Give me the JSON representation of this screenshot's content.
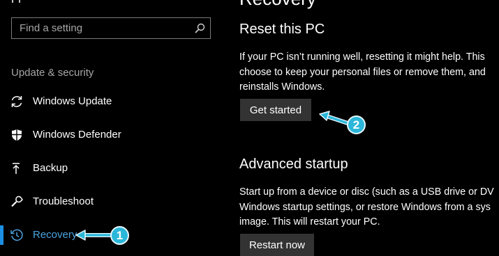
{
  "sidebar": {
    "search": {
      "placeholder": "Find a setting",
      "value": ""
    },
    "section_label": "Update & security",
    "items": [
      {
        "label": "Windows Update",
        "icon": "sync-icon",
        "selected": false
      },
      {
        "label": "Windows Defender",
        "icon": "shield-icon",
        "selected": false
      },
      {
        "label": "Backup",
        "icon": "backup-arrow-icon",
        "selected": false
      },
      {
        "label": "Troubleshoot",
        "icon": "wrench-icon",
        "selected": false
      },
      {
        "label": "Recovery",
        "icon": "history-icon",
        "selected": true
      }
    ]
  },
  "main": {
    "title": "Recovery",
    "reset": {
      "heading": "Reset this PC",
      "description_lines": [
        "If your PC isn’t running well, resetting it might help. This",
        "choose to keep your personal files or remove them, and",
        "reinstalls Windows."
      ],
      "button_label": "Get started"
    },
    "advanced": {
      "heading": "Advanced startup",
      "description_lines": [
        "Start up from a device or disc (such as a USB drive or DV",
        "Windows startup settings, or restore Windows from a sys",
        "image. This will restart your PC."
      ],
      "button_label": "Restart now"
    }
  },
  "annotations": [
    {
      "number": "1",
      "target": "Recovery"
    },
    {
      "number": "2",
      "target": "Get started"
    }
  ],
  "colors": {
    "background": "#000000",
    "accent": "#1b8fe4",
    "selected_text": "#4aa3df",
    "button_bg": "#333333",
    "callout": "#2bb7da"
  }
}
